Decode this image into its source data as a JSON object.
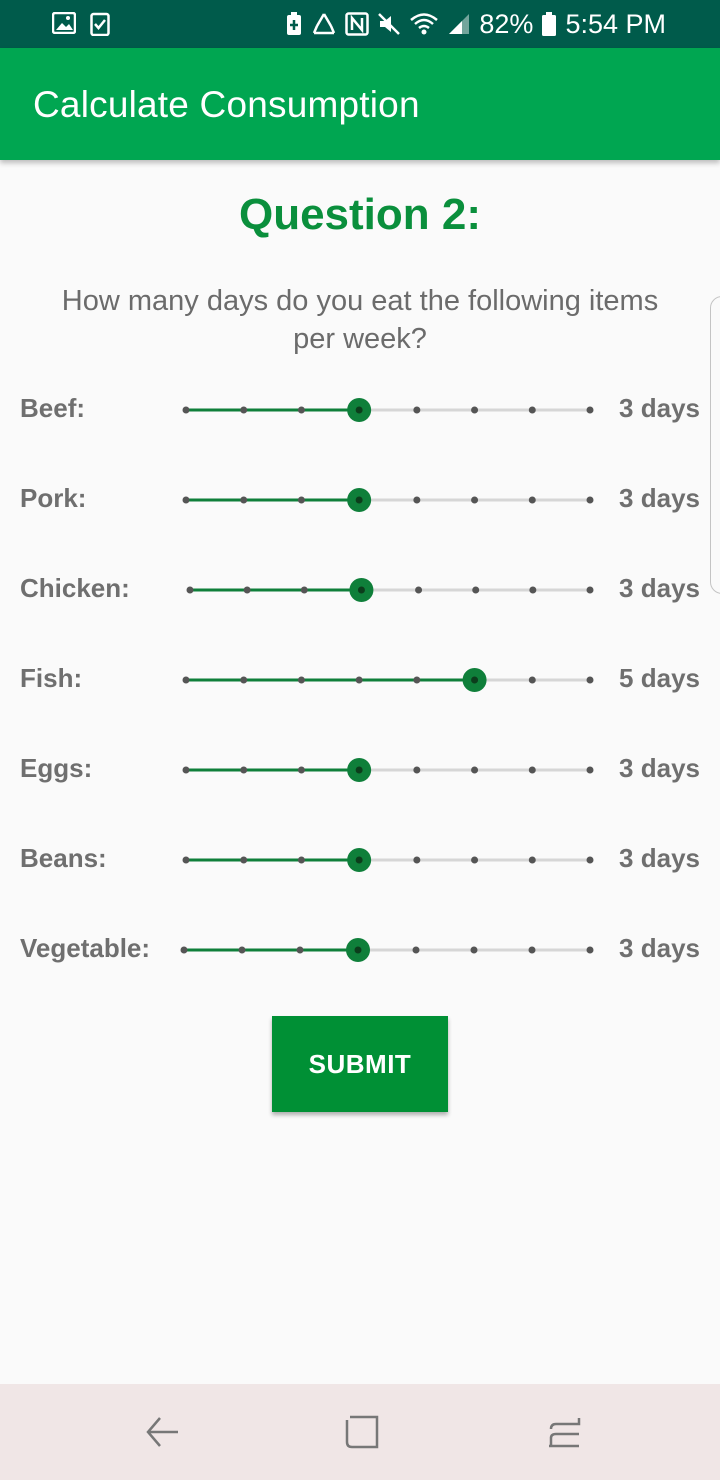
{
  "status_bar": {
    "battery_percent": "82%",
    "time": "5:54 PM",
    "left_icons": [
      "image-icon",
      "checklist-icon"
    ],
    "right_icons": [
      "battery-saver-icon",
      "recycle-icon",
      "nfc-icon",
      "mute-icon",
      "wifi-icon",
      "signal-icon",
      "battery-icon"
    ]
  },
  "app_bar": {
    "title": "Calculate Consumption"
  },
  "question": {
    "heading": "Question 2:",
    "text": "How many days do you eat the following items per week?"
  },
  "slider_max_days": 7,
  "items": [
    {
      "label": "Beef:",
      "days": 3,
      "value_text": "3 days"
    },
    {
      "label": "Pork:",
      "days": 3,
      "value_text": "3 days"
    },
    {
      "label": "Chicken:",
      "days": 3,
      "value_text": "3 days"
    },
    {
      "label": "Fish:",
      "days": 5,
      "value_text": "5 days"
    },
    {
      "label": "Eggs:",
      "days": 3,
      "value_text": "3 days"
    },
    {
      "label": "Beans:",
      "days": 3,
      "value_text": "3 days"
    },
    {
      "label": "Vegetable:",
      "days": 3,
      "value_text": "3 days"
    }
  ],
  "submit": {
    "label": "SUBMIT"
  },
  "nav_bar": {
    "icons": [
      "back-icon",
      "recents-icon",
      "overview-icon"
    ]
  },
  "colors": {
    "status_bar": "#005b4b",
    "app_bar": "#00a651",
    "accent": "#0a8f3c",
    "slider_active": "#0f7f3a",
    "slider_inactive": "#d6d6d6",
    "submit_button": "#009035",
    "nav_bar": "#f0e6e6"
  }
}
